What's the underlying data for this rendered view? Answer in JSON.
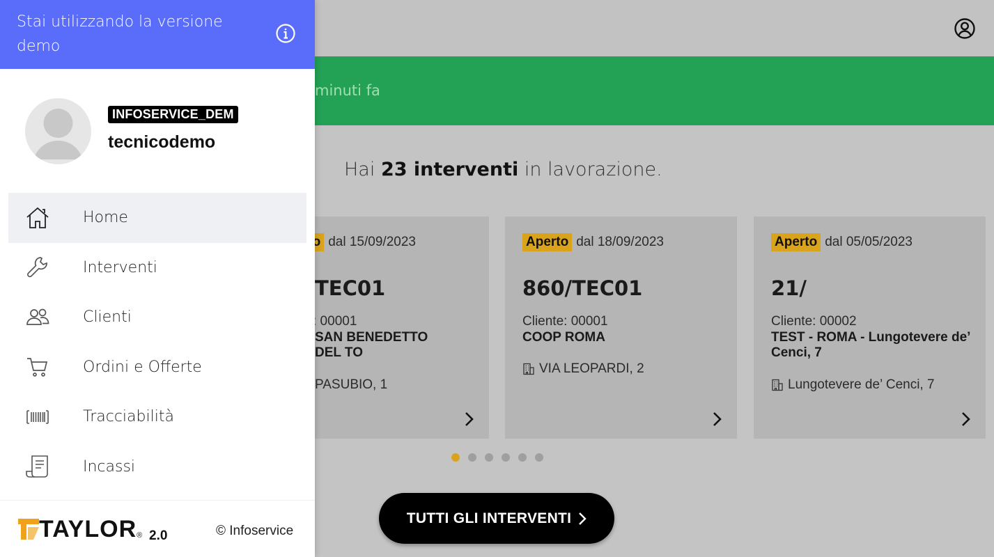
{
  "drawer": {
    "demo_banner": "Stai utilizzando la versione demo",
    "company": "INFOSERVICE_DEM",
    "username": "tecnicodemo",
    "menu": [
      {
        "label": "Home",
        "icon": "home-icon",
        "active": true
      },
      {
        "label": "Interventi",
        "icon": "wrench-icon",
        "active": false
      },
      {
        "label": "Clienti",
        "icon": "users-icon",
        "active": false
      },
      {
        "label": "Ordini e Offerte",
        "icon": "cart-icon",
        "active": false
      },
      {
        "label": "Tracciabilità",
        "icon": "barcode-icon",
        "active": false
      },
      {
        "label": "Incassi",
        "icon": "receipt-icon",
        "active": false
      }
    ],
    "footer": {
      "logo": "TAYLOR",
      "logo_reg": "®",
      "version": "2.0",
      "copyright": "© Infoservice"
    }
  },
  "main": {
    "sync_text": "minuti fa",
    "summary": {
      "prefix": "Hai",
      "count": "23 interventi",
      "suffix": "in lavorazione."
    },
    "cards": [
      {
        "status": "Aperto",
        "since": "dal 15/09/2023",
        "number": "TEC01",
        "client": ": 00001",
        "client_name": "SAN BENEDETTO DEL TO",
        "address": "PASUBIO, 1"
      },
      {
        "status": "Aperto",
        "since": "dal 18/09/2023",
        "number": "860/TEC01",
        "client": "Cliente: 00001",
        "client_name": "COOP ROMA",
        "address": "VIA LEOPARDI, 2"
      },
      {
        "status": "Aperto",
        "since": "dal 05/05/2023",
        "number": "21/",
        "client": "Cliente: 00002",
        "client_name": "TEST - ROMA - Lungotevere de’ Cenci, 7",
        "address": "Lungotevere de’ Cenci, 7"
      }
    ],
    "pagination": {
      "pages": 6,
      "current": 1
    },
    "all_button": "TUTTI GLI INTERVENTI"
  },
  "colors": {
    "accent": "#5a6cfa",
    "success": "#23a155",
    "badge": "#d9a31b"
  }
}
